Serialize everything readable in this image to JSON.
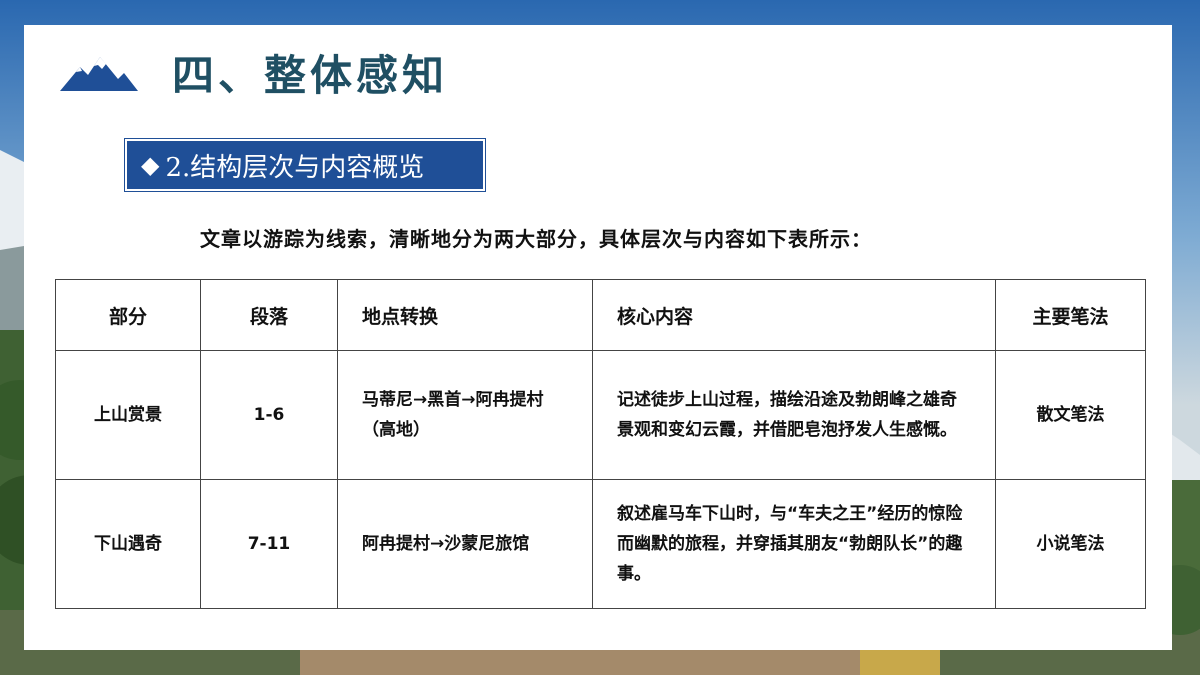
{
  "header": {
    "title": "四、整体感知",
    "logo_icon": "mountain-icon"
  },
  "section": {
    "marker": "◆",
    "label": "2.结构层次与内容概览"
  },
  "intro": "文章以游踪为线索，清晰地分为两大部分，具体层次与内容如下表所示：",
  "table": {
    "headers": [
      "部分",
      "段落",
      "地点转换",
      "核心内容",
      "主要笔法"
    ],
    "rows": [
      [
        "上山赏景",
        "1-6",
        "马蒂尼→黑首→阿冉提村（高地）",
        "记述徒步上山过程，描绘沿途及勃朗峰之雄奇景观和变幻云霞，并借肥皂泡抒发人生感慨。",
        "散文笔法"
      ],
      [
        "下山遇奇",
        "7-11",
        "阿冉提村→沙蒙尼旅馆",
        "叙述雇马车下山时，与“车夫之王”经历的惊险而幽默的旅程，并穿插其朋友“勃朗队长”的趣事。",
        "小说笔法"
      ]
    ]
  },
  "colors": {
    "title": "#1f4f63",
    "badge": "#1f4f97",
    "logo": "#1f4f97"
  }
}
